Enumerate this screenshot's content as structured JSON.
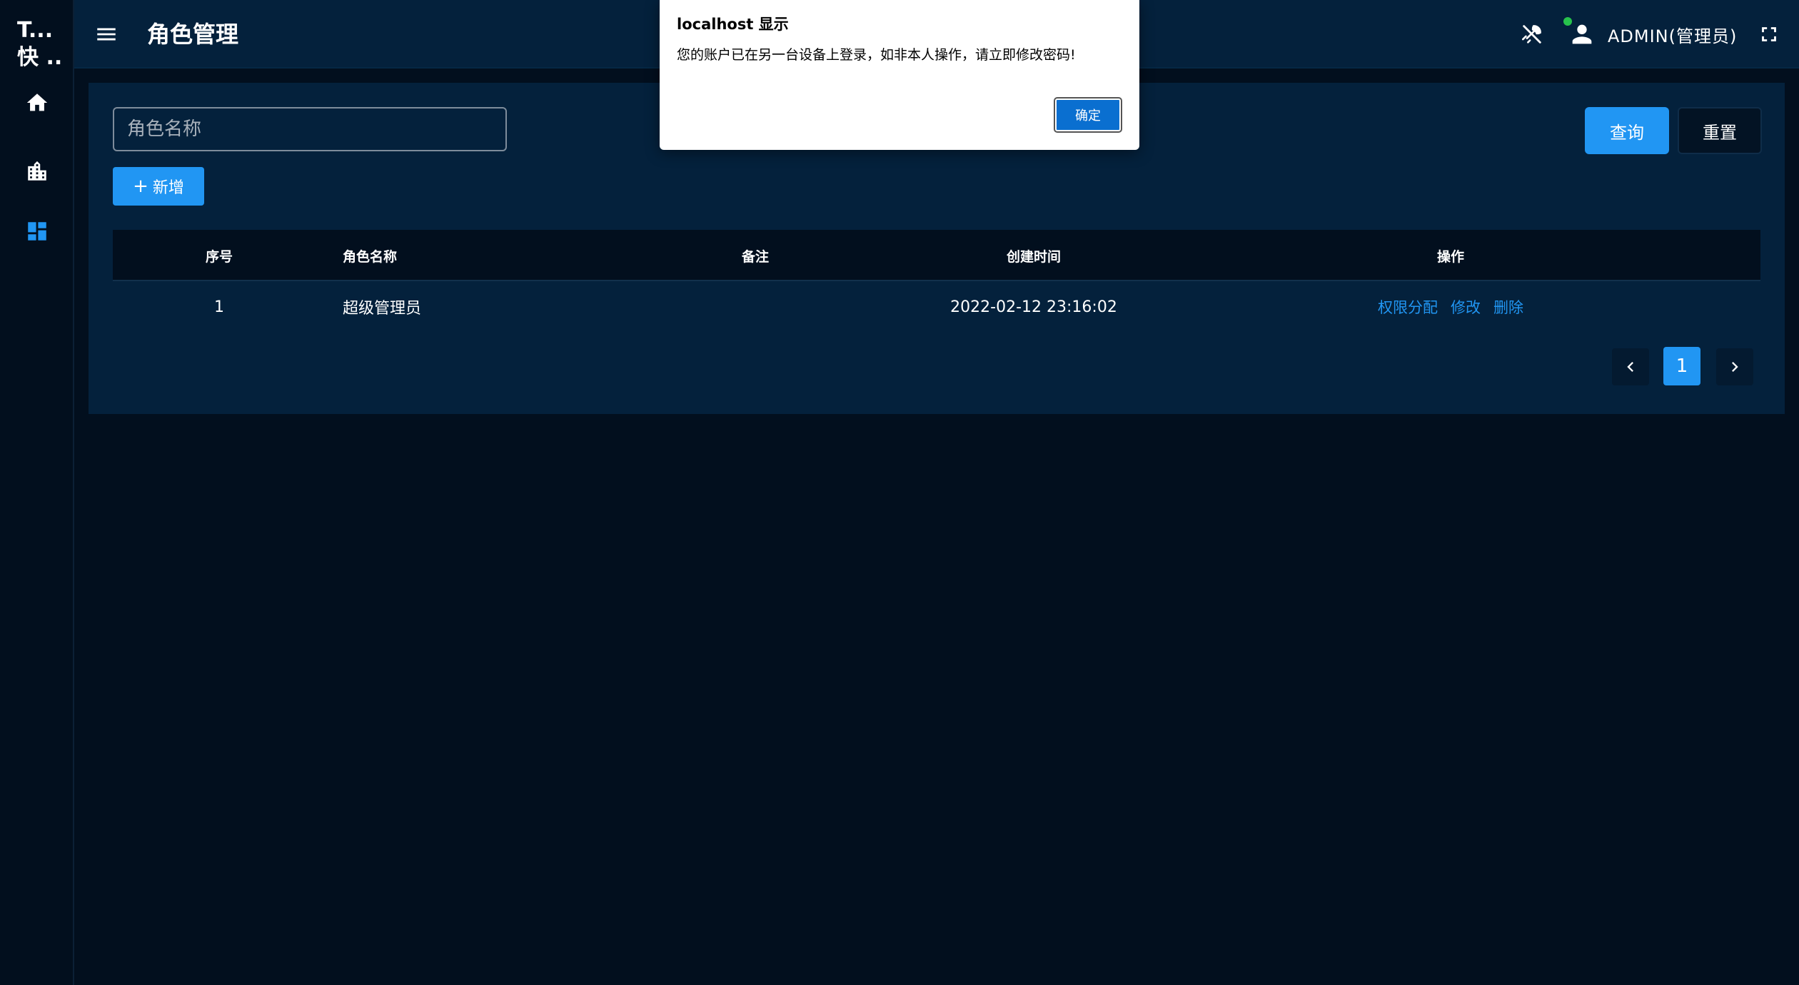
{
  "brand": {
    "line1": "T...",
    "line2": "快 .."
  },
  "sidebar": {
    "items": [
      {
        "name": "home",
        "icon": "home-icon",
        "color": "#ffffff"
      },
      {
        "name": "building",
        "icon": "building-icon",
        "color": "#ffffff"
      },
      {
        "name": "dashboard",
        "icon": "dashboard-icon",
        "color": "#2196f3"
      }
    ]
  },
  "header": {
    "title": "角色管理",
    "user_label": "ADMIN(管理员)",
    "status_color": "#27c24c"
  },
  "search": {
    "placeholder": "角色名称",
    "value": ""
  },
  "toolbar": {
    "query_label": "查询",
    "reset_label": "重置",
    "add_icon": "+",
    "add_label": "新增"
  },
  "table": {
    "columns": [
      "序号",
      "角色名称",
      "备注",
      "创建时间",
      "操作"
    ],
    "rows": [
      {
        "index": "1",
        "role_name": "超级管理员",
        "remark": "",
        "created_at": "2022-02-12 23:16:02",
        "actions": [
          "权限分配",
          "修改",
          "删除"
        ]
      }
    ]
  },
  "pagination": {
    "current_page": "1"
  },
  "dialog": {
    "title": "localhost 显示",
    "message": "您的账户已在另一台设备上登录，如非本人操作，请立即修改密码!",
    "ok_label": "确定"
  },
  "colors": {
    "accent": "#2196f3",
    "background": "#020f1e",
    "panel": "#04213c"
  }
}
